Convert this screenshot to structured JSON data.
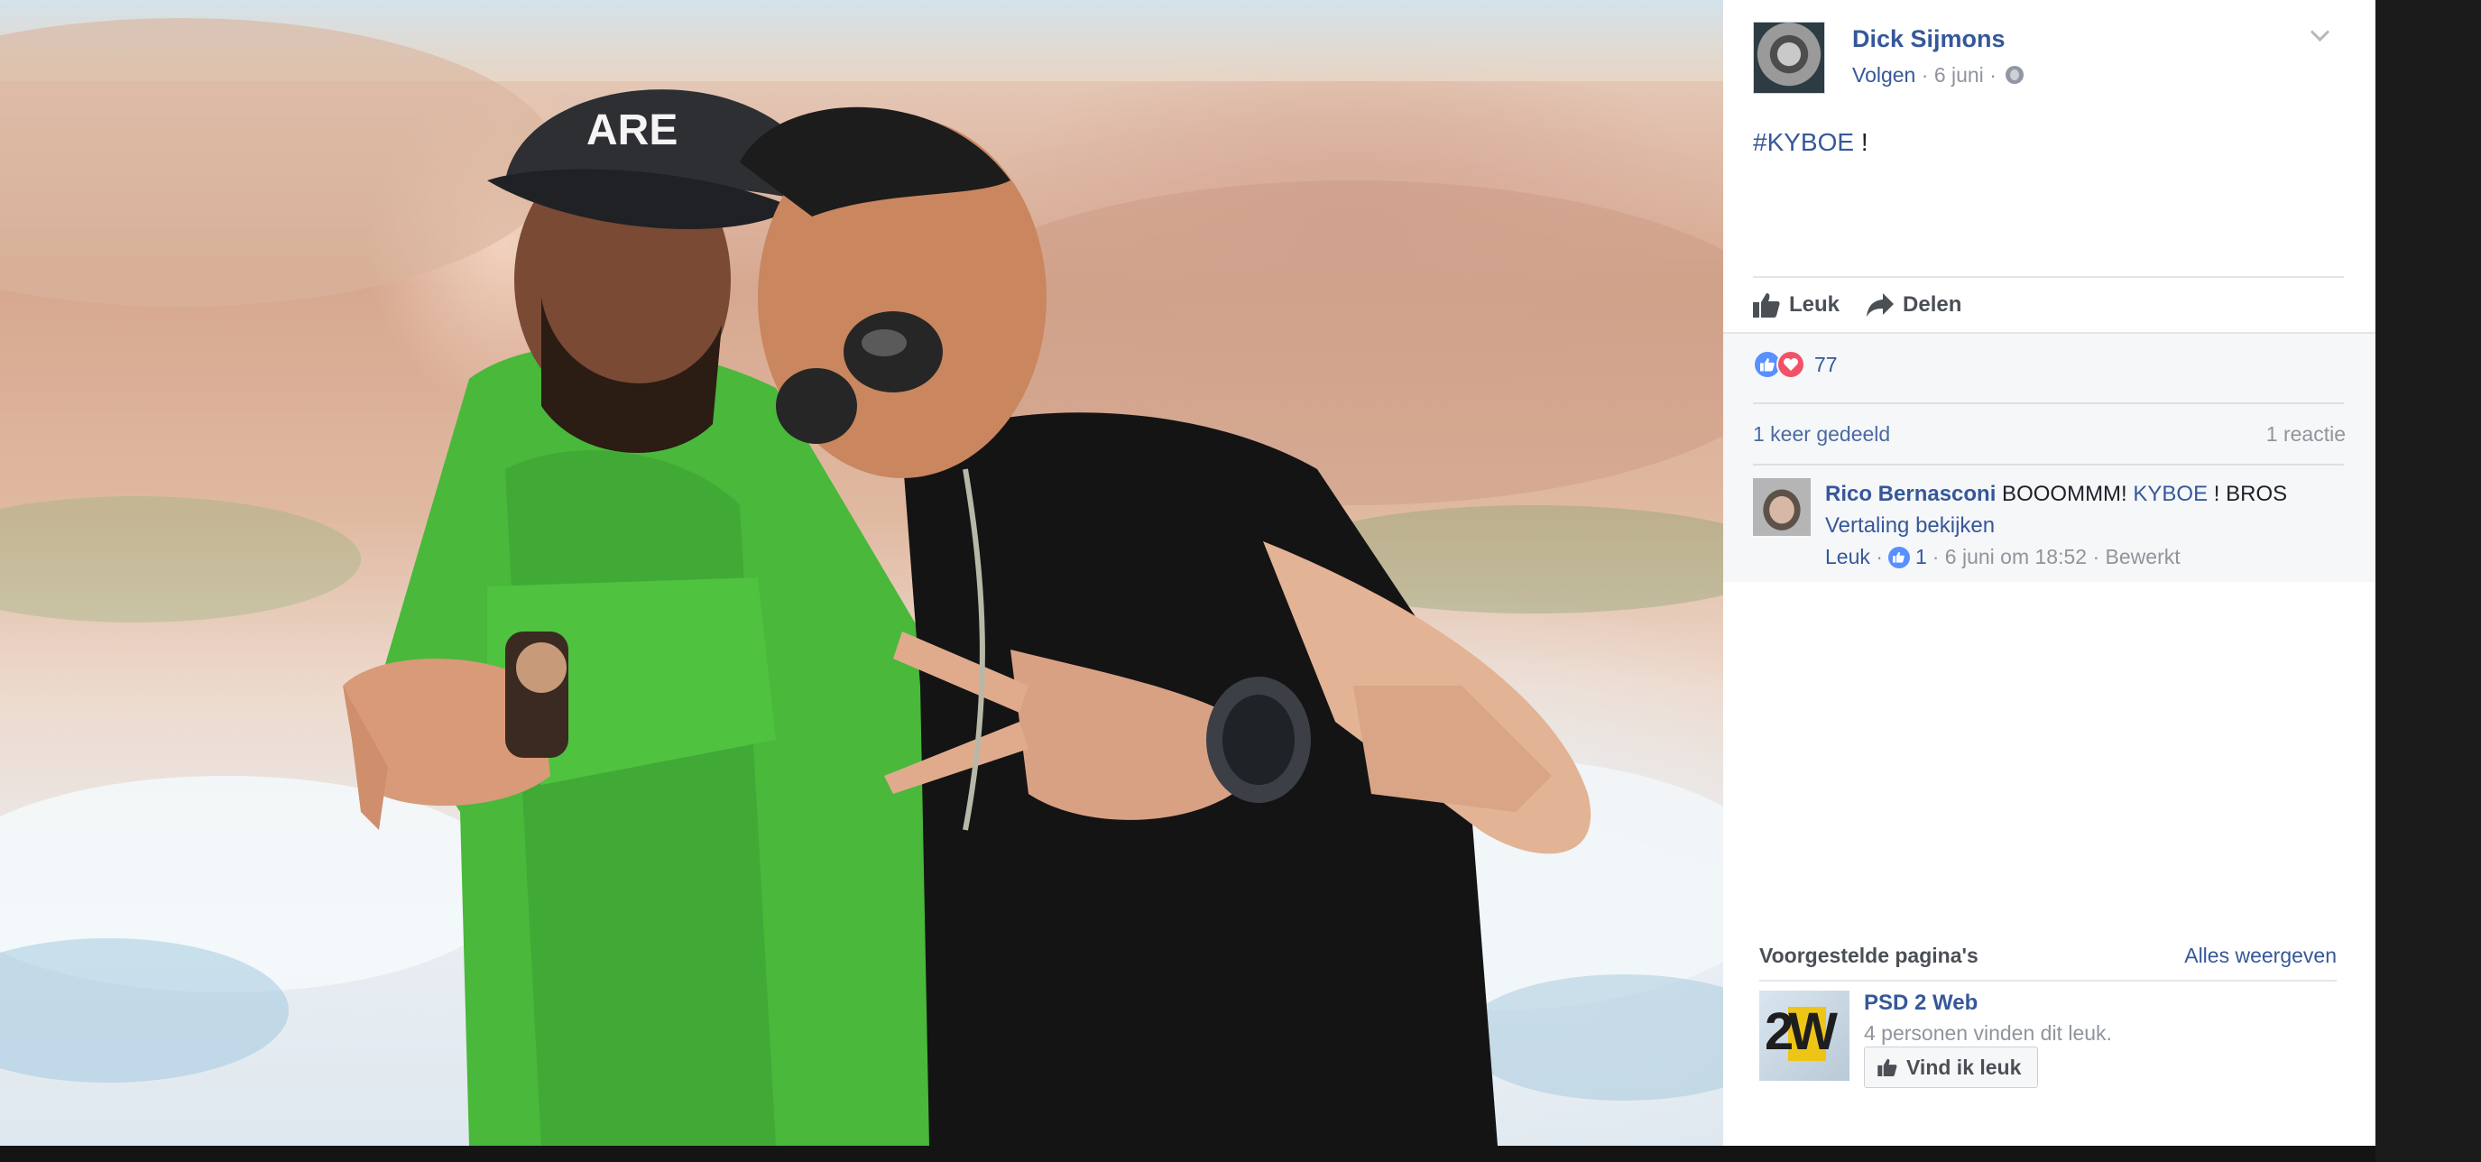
{
  "post": {
    "author": "Dick Sijmons",
    "follow": "Volgen",
    "date": "6 juni",
    "hashtag": "#KYBOE",
    "text_suffix": " !",
    "privacy_icon": "globe-icon"
  },
  "actions": {
    "like": "Leuk",
    "share": "Delen"
  },
  "feedback": {
    "reaction_count": "77",
    "shares": "1 keer gedeeld",
    "replies": "1 reactie"
  },
  "comment": {
    "author": "Rico Bernasconi",
    "text_before": " BOOOMMM! ",
    "link": "KYBOE",
    "text_after": " ! BROS",
    "translate": "Vertaling bekijken",
    "like": "Leuk",
    "like_count": "1",
    "timestamp": "6 juni om 18:52",
    "edited": "Bewerkt"
  },
  "suggested": {
    "title": "Voorgestelde pagina's",
    "see_all": "Alles weergeven",
    "page_name": "PSD 2 Web",
    "page_logo_text": "2W",
    "page_likes": "4 personen vinden dit leuk.",
    "like_button": "Vind ik leuk"
  },
  "colors": {
    "link_blue": "#365899",
    "like_blue": "#5890ff",
    "love_red": "#f25268"
  }
}
